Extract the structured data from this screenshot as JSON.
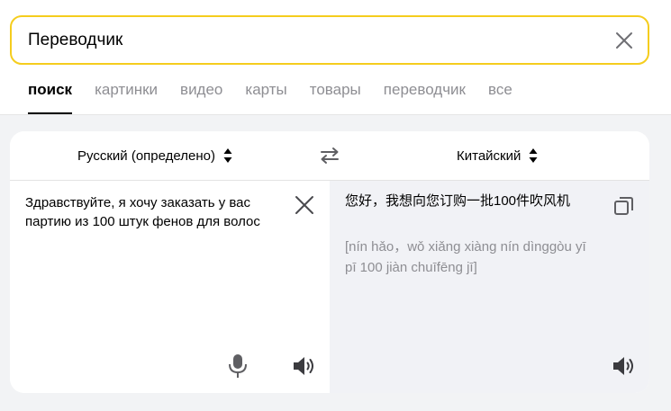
{
  "search": {
    "value": "Переводчик"
  },
  "tabs": [
    {
      "label": "поиск",
      "active": true
    },
    {
      "label": "картинки"
    },
    {
      "label": "видео"
    },
    {
      "label": "карты"
    },
    {
      "label": "товары"
    },
    {
      "label": "переводчик"
    },
    {
      "label": "все"
    }
  ],
  "translator": {
    "source_language": "Русский (определено)",
    "target_language": "Китайский",
    "source_text": "Здравствуйте, я хочу заказать у вас партию из 100 штук фенов для волос",
    "translation": "您好，我想向您订购一批100件吹风机",
    "transliteration": "[nín hǎo，wǒ xiǎng xiàng nín dìnggòu yī pī 100 jiàn chuīfēng jī]"
  },
  "icons": {
    "clear": "close-icon",
    "swap": "swap-arrows-icon",
    "mic": "microphone-icon",
    "speaker": "speaker-icon",
    "copy": "copy-icon",
    "sort": "updown-arrows-icon"
  },
  "colors": {
    "search_border": "#f5cd1e",
    "target_pane_bg": "#f1f2f6",
    "inactive_tab": "#8e8e93"
  }
}
